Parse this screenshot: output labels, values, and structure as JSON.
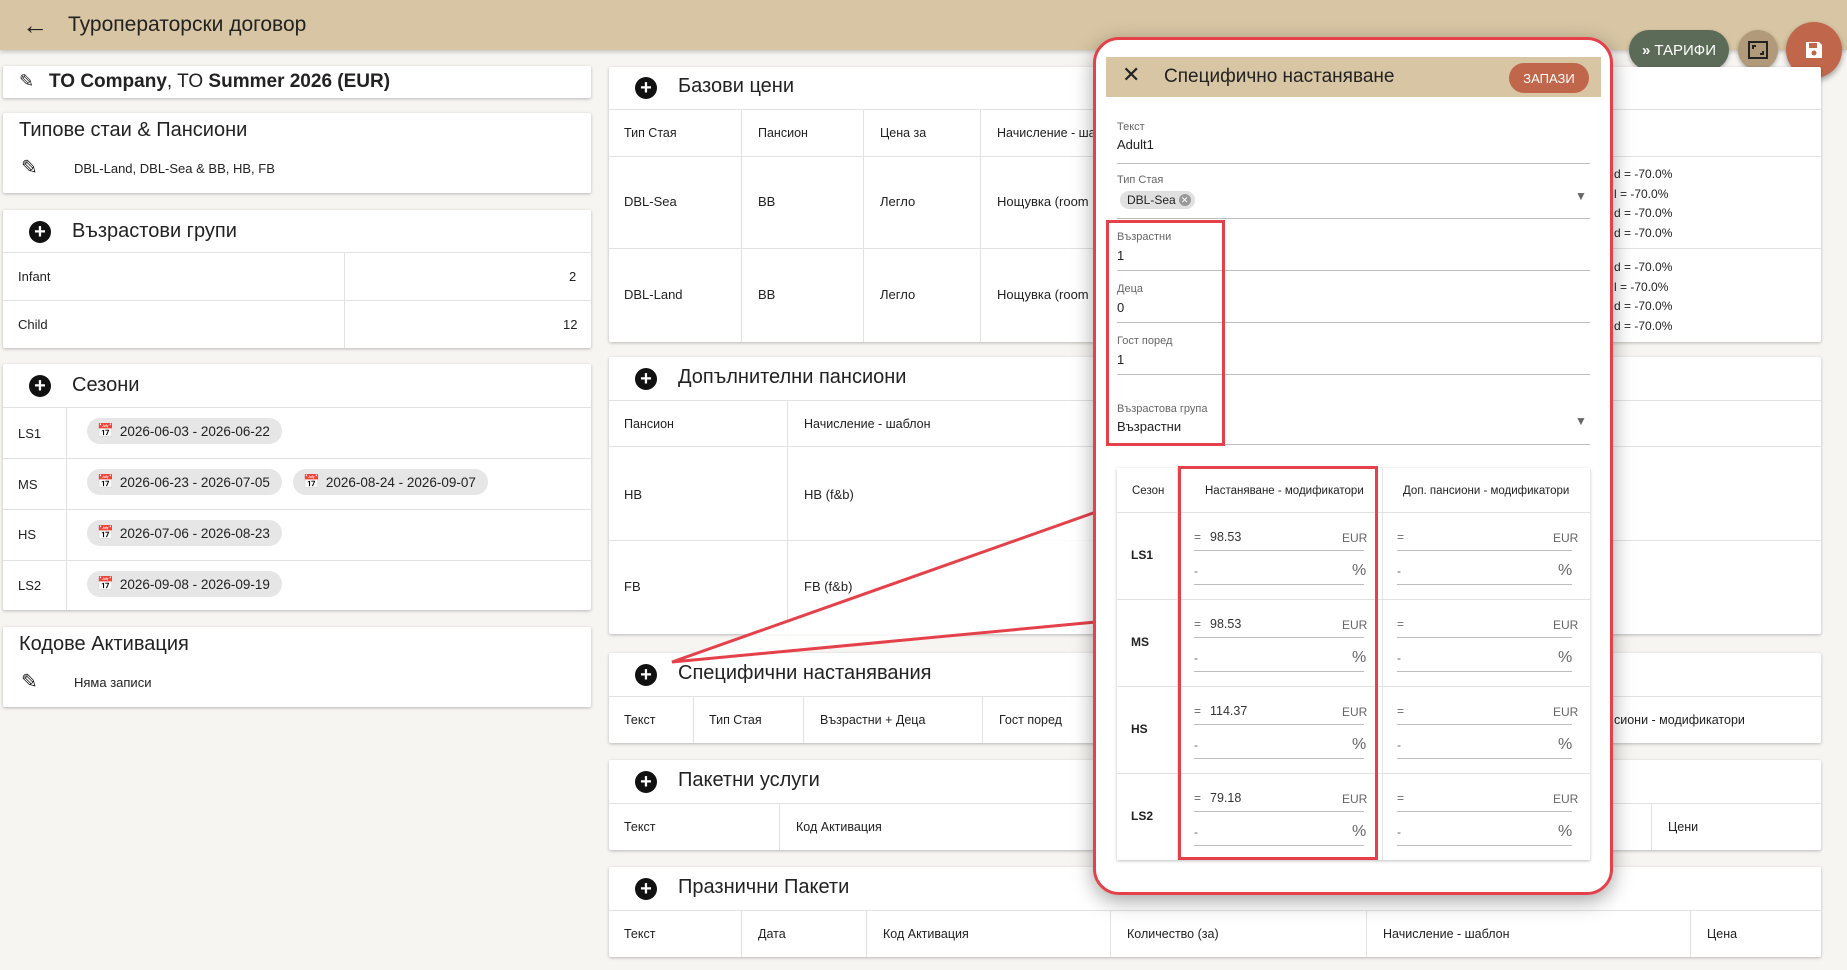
{
  "header": {
    "title": "Туроператорски договор",
    "tarifi_label": "ТАРИФИ"
  },
  "contract_title": {
    "bold1": "TO Company",
    "sep1": ", ",
    "normal": "TO",
    "bold2": " Summer 2026 (EUR)"
  },
  "room_types": {
    "title": "Типове стаи & Пансиони",
    "value": "DBL-Land, DBL-Sea & BB, HB, FB"
  },
  "age_groups": {
    "title": "Възрастови групи",
    "rows": [
      {
        "name": "Infant",
        "age": "2"
      },
      {
        "name": "Child",
        "age": "12"
      }
    ]
  },
  "seasons": {
    "title": "Сезони",
    "rows": [
      {
        "code": "LS1",
        "ranges": [
          "2026-06-03 - 2026-06-22"
        ]
      },
      {
        "code": "MS",
        "ranges": [
          "2026-06-23 - 2026-07-05",
          "2026-08-24 - 2026-09-07"
        ]
      },
      {
        "code": "HS",
        "ranges": [
          "2026-07-06 - 2026-08-23"
        ]
      },
      {
        "code": "LS2",
        "ranges": [
          "2026-09-08 - 2026-09-19"
        ]
      }
    ]
  },
  "activation_codes": {
    "title": "Кодове Активация",
    "empty": "Няма записи"
  },
  "base_prices": {
    "title": "Базови цени",
    "headers": [
      "Тип Стая",
      "Пансион",
      "Цена за",
      "Начисление - ша"
    ],
    "rows": [
      {
        "room": "DBL-Sea",
        "board": "BB",
        "price_for": "Легло",
        "charge": "Нощувка (room"
      },
      {
        "room": "DBL-Land",
        "board": "BB",
        "price_for": "Легло",
        "charge": "Нощувка (room"
      }
    ],
    "right_values": [
      "d = -70.0%",
      "l = -70.0%",
      "d = -70.0%",
      "d = -70.0%",
      "d = -70.0%",
      "l = -70.0%",
      "d = -70.0%",
      "d = -70.0%"
    ]
  },
  "extra_boards": {
    "title": "Допълнителни пансиони",
    "headers": [
      "Пансион",
      "Начисление - шаблон"
    ],
    "rows": [
      {
        "board": "HB",
        "charge": "HB (f&b)"
      },
      {
        "board": "FB",
        "charge": "FB (f&b)"
      }
    ]
  },
  "specific_accommodations": {
    "title": "Специфични настанявания",
    "headers": [
      "Текст",
      "Тип Стая",
      "Възрастни + Деца",
      "Гост поред"
    ],
    "right_header": "сиони - модификатори"
  },
  "package_services": {
    "title": "Пакетни услуги",
    "headers": [
      "Текст",
      "Код Активация"
    ],
    "right_header": "Цени"
  },
  "holiday_packages": {
    "title": "Празнични Пакети",
    "headers": [
      "Текст",
      "Дата",
      "Код Активация",
      "Количество (за)",
      "Начисление - шаблон",
      "Цена"
    ]
  },
  "modal": {
    "title": "Специфично настаняване",
    "save_label": "ЗАПАЗИ",
    "text_label": "Текст",
    "text_value": "Adult1",
    "room_label": "Тип Стая",
    "room_chip": "DBL-Sea",
    "adults_label": "Възрастни",
    "adults_value": "1",
    "children_label": "Деца",
    "children_value": "0",
    "guest_label": "Гост поред",
    "guest_value": "1",
    "agegroup_label": "Възрастова група",
    "agegroup_value": "Възрастни",
    "grid": {
      "headers": [
        "Сезон",
        "Настаняване - модификатори",
        "Доп. пансиони - модификатори"
      ],
      "rows": [
        {
          "season": "LS1",
          "amount": "98.53"
        },
        {
          "season": "MS",
          "amount": "98.53"
        },
        {
          "season": "HS",
          "amount": "114.37"
        },
        {
          "season": "LS2",
          "amount": "79.18"
        }
      ],
      "eq": "=",
      "dash": "-",
      "currency": "EUR",
      "pct": "%"
    }
  }
}
